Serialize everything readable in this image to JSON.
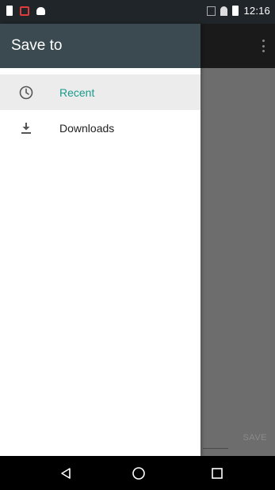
{
  "status_bar": {
    "time": "12:16"
  },
  "drawer": {
    "title": "Save to",
    "items": [
      {
        "label": "Recent",
        "icon": "clock-icon",
        "active": true
      },
      {
        "label": "Downloads",
        "icon": "download-icon",
        "active": false
      }
    ]
  },
  "app": {
    "save_label": "SAVE"
  },
  "nav_bar": {
    "buttons": [
      "back-icon",
      "home-icon",
      "recents-icon"
    ]
  },
  "colors": {
    "accent": "#1a9a8c",
    "drawer_header": "#3a4a50",
    "scrim": "#6d6d6d"
  }
}
